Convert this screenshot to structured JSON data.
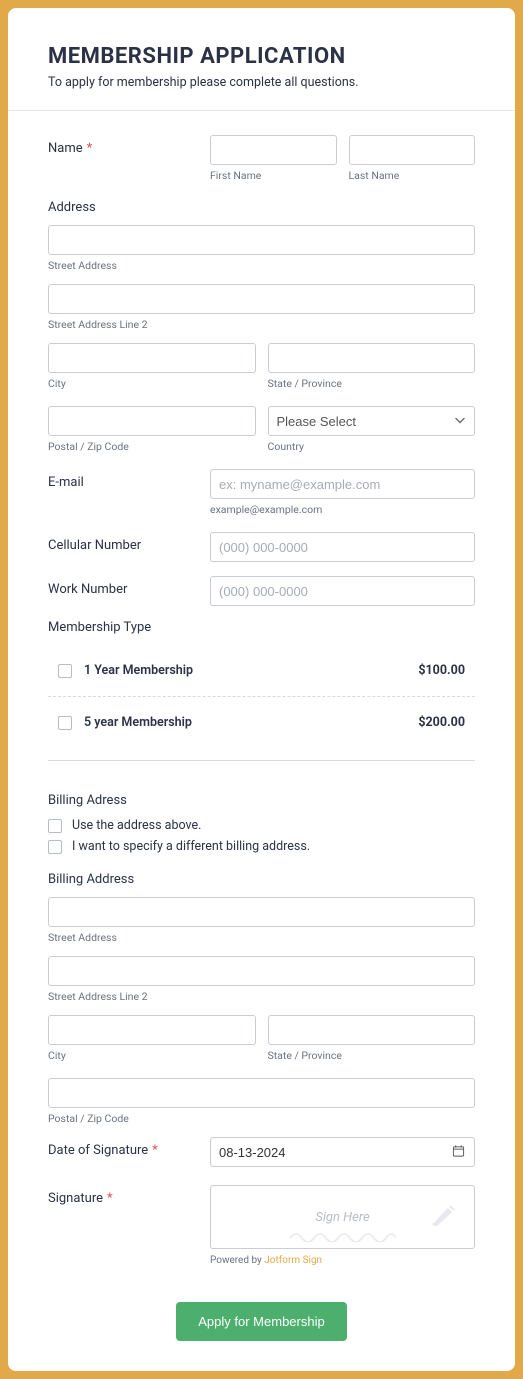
{
  "header": {
    "title": "MEMBERSHIP APPLICATION",
    "subtitle": "To apply for membership please complete all questions."
  },
  "name": {
    "label": "Name",
    "first_sub": "First Name",
    "last_sub": "Last Name"
  },
  "address": {
    "label": "Address",
    "street_sub": "Street Address",
    "street2_sub": "Street Address Line 2",
    "city_sub": "City",
    "state_sub": "State / Province",
    "postal_sub": "Postal / Zip Code",
    "country_sub": "Country",
    "country_placeholder": "Please Select"
  },
  "email": {
    "label": "E-mail",
    "placeholder": "ex: myname@example.com",
    "sub": "example@example.com"
  },
  "cell": {
    "label": "Cellular Number",
    "placeholder": "(000) 000-0000"
  },
  "work": {
    "label": "Work Number",
    "placeholder": "(000) 000-0000"
  },
  "membership": {
    "label": "Membership Type",
    "options": [
      {
        "label": "1 Year Membership",
        "price": "$100.00"
      },
      {
        "label": "5 year Membership",
        "price": "$200.00"
      }
    ]
  },
  "billing_choice": {
    "label": "Billing Adress",
    "opt1": "Use the address above.",
    "opt2": "I want to specify a different billing address."
  },
  "billing": {
    "label": "Billing Address",
    "street_sub": "Street Address",
    "street2_sub": "Street Address Line 2",
    "city_sub": "City",
    "state_sub": "State / Province",
    "postal_sub": "Postal / Zip Code"
  },
  "date": {
    "label": "Date of Signature",
    "value": "08-13-2024"
  },
  "signature": {
    "label": "Signature",
    "placeholder": "Sign Here",
    "powered_prefix": "Powered by ",
    "powered_link": "Jotform Sign"
  },
  "submit": {
    "label": "Apply for Membership"
  }
}
